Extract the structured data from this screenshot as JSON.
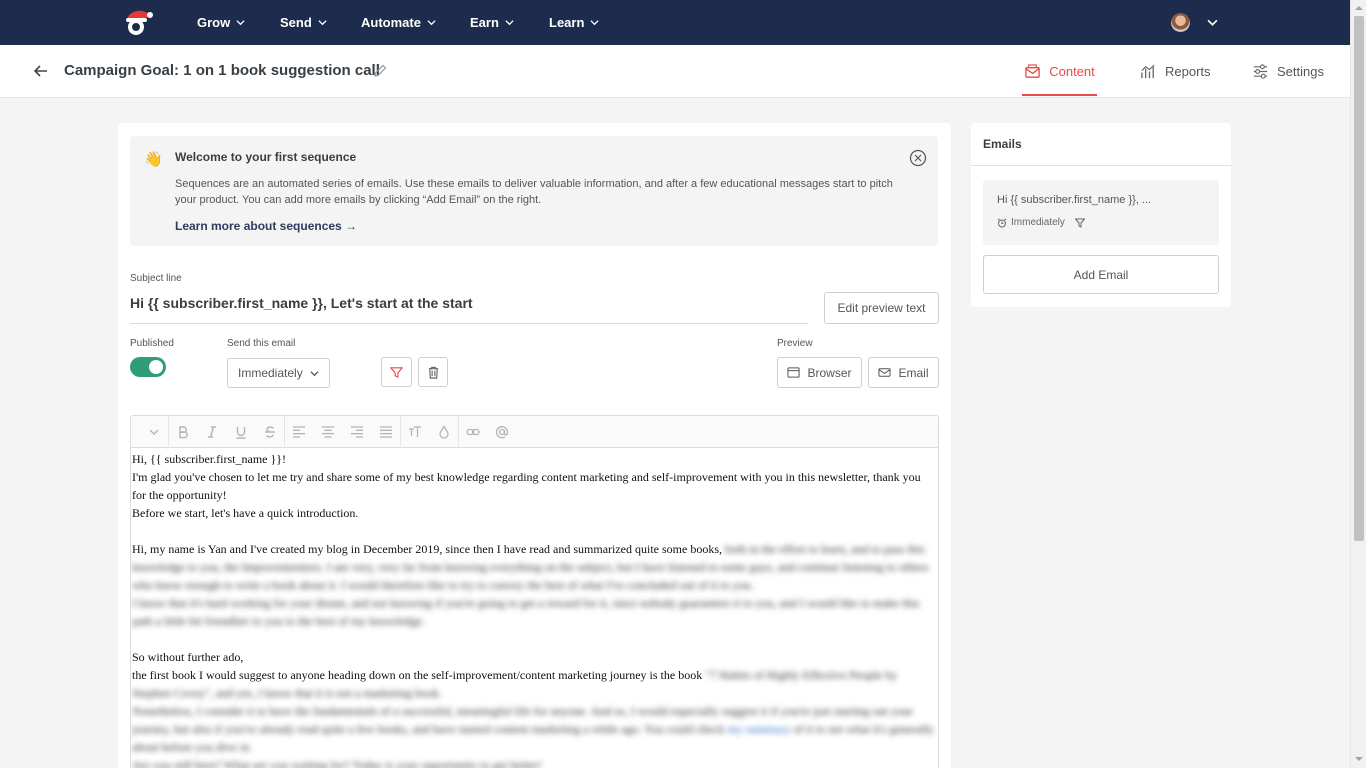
{
  "nav": {
    "items": [
      {
        "label": "Grow"
      },
      {
        "label": "Send"
      },
      {
        "label": "Automate"
      },
      {
        "label": "Earn"
      },
      {
        "label": "Learn"
      }
    ]
  },
  "header": {
    "title": "Campaign Goal: 1 on 1 book suggestion call",
    "tabs": [
      {
        "label": "Content",
        "active": true
      },
      {
        "label": "Reports"
      },
      {
        "label": "Settings"
      }
    ]
  },
  "welcome": {
    "title": "Welcome to your first sequence",
    "text": "Sequences are an automated series of emails. Use these emails to deliver valuable information, and after a few educational messages start to pitch your product. You can add more emails by clicking “Add Email” on the right.",
    "link": "Learn more about sequences →"
  },
  "subject": {
    "label": "Subject line",
    "value": "Hi {{ subscriber.first_name }}, Let's start at the start",
    "edit_preview": "Edit preview text"
  },
  "controls": {
    "published_label": "Published",
    "published": true,
    "send_label": "Send this email",
    "send_value": "Immediately",
    "preview_label": "Preview",
    "browser": "Browser",
    "email": "Email"
  },
  "editor": {
    "p1": "Hi, {{ subscriber.first_name }}!",
    "p2": "I'm glad you've chosen to let me try and share some of my best knowledge regarding content marketing and self-improvement with you in this newsletter, thank you for the opportunity!",
    "p3": "Before we start, let's have a quick introduction.",
    "p4_clear": "Hi, my name is Yan and I've created my blog in December 2019, since then I have read and summarized quite some books,",
    "p5": "So without further ado,",
    "p6_clear": "the first book I would suggest to anyone heading down on the self-improvement/content marketing journey is the book"
  },
  "sidebar": {
    "title": "Emails",
    "email_subject": "Hi {{ subscriber.first_name }}, ...",
    "email_timing": "Immediately",
    "add_email": "Add Email"
  },
  "colors": {
    "nav_bg": "#1d2c4c",
    "accent": "#e84a4a",
    "toggle_on": "#2e9e7a"
  }
}
